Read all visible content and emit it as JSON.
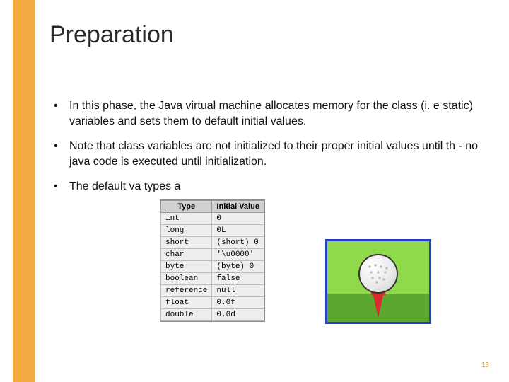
{
  "title": "Preparation",
  "bullets": [
    "In this phase, the Java virtual machine allocates memory for the class (i. e static) variables and sets them to default initial values.",
    "Note that class variables are not initialized to their proper initial values until th                                           - no java code is executed until initialization.",
    "The default va                                    types a"
  ],
  "table": {
    "headers": [
      "Type",
      "Initial Value"
    ],
    "rows": [
      [
        "int",
        "0"
      ],
      [
        "long",
        "0L"
      ],
      [
        "short",
        "(short) 0"
      ],
      [
        "char",
        "'\\u0000'"
      ],
      [
        "byte",
        "(byte) 0"
      ],
      [
        "boolean",
        "false"
      ],
      [
        "reference",
        "null"
      ],
      [
        "float",
        "0.0f"
      ],
      [
        "double",
        "0.0d"
      ]
    ]
  },
  "pageNumber": "13"
}
